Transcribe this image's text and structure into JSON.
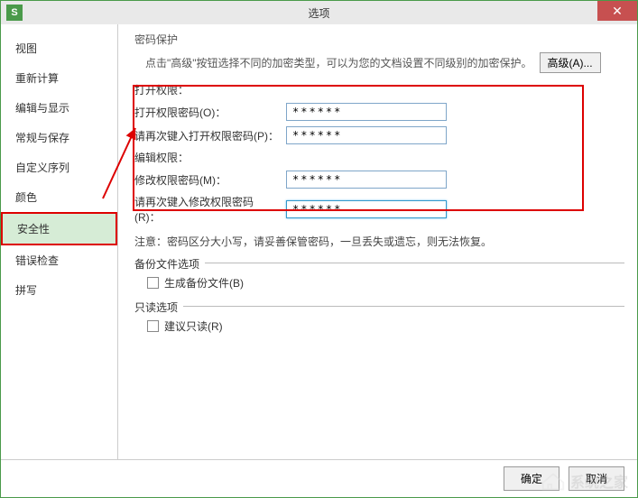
{
  "window": {
    "app_icon_text": "S",
    "title": "选项",
    "close_glyph": "✕"
  },
  "sidebar": {
    "items": [
      {
        "label": "视图"
      },
      {
        "label": "重新计算"
      },
      {
        "label": "编辑与显示"
      },
      {
        "label": "常规与保存"
      },
      {
        "label": "自定义序列"
      },
      {
        "label": "颜色"
      },
      {
        "label": "安全性",
        "selected": true
      },
      {
        "label": "错误检查"
      },
      {
        "label": "拼写"
      }
    ]
  },
  "content": {
    "password_protect_label": "密码保护",
    "hint": "点击\"高级\"按钮选择不同的加密类型，可以为您的文档设置不同级别的加密保护。",
    "advanced_button": "高级(A)...",
    "open_perm": {
      "title": "打开权限：",
      "label1": "打开权限密码(O)：",
      "value1": "******",
      "label2": "请再次键入打开权限密码(P)：",
      "value2": "******"
    },
    "edit_perm": {
      "title": "编辑权限：",
      "label1": "修改权限密码(M)：",
      "value1": "******",
      "label2": "请再次键入修改权限密码(R)：",
      "value2": "******"
    },
    "note": "注意：密码区分大小写，请妥善保管密码，一旦丢失或遗忘，则无法恢复。",
    "backup_section": {
      "title": "备份文件选项",
      "checkbox_label": "生成备份文件(B)"
    },
    "readonly_section": {
      "title": "只读选项",
      "checkbox_label": "建议只读(R)"
    }
  },
  "footer": {
    "ok": "确定",
    "cancel": "取消"
  },
  "watermark": {
    "text": "系统之家"
  }
}
